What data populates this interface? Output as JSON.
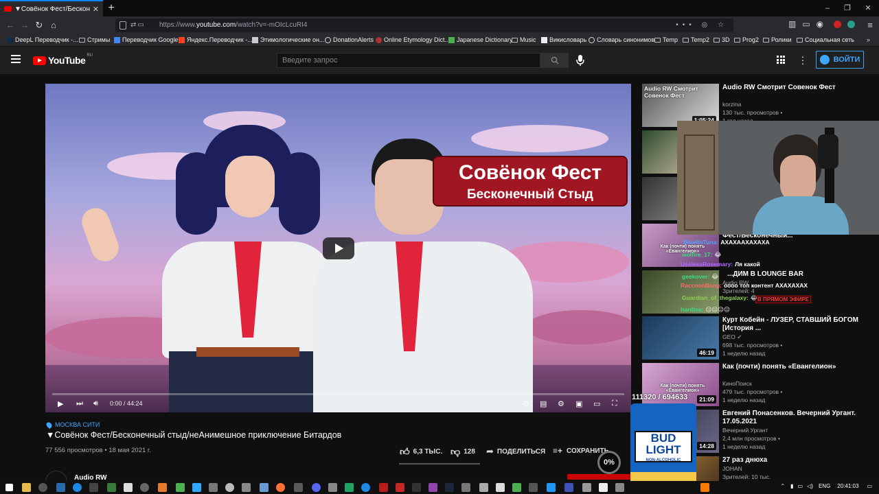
{
  "browser": {
    "tab_title": "▼Совёнок Фест/Бесконечный",
    "new_tab": "+",
    "url_prefix": "https://www.",
    "url_host": "youtube.com",
    "url_rest": "/watch?v=-mOIcLcuRI4",
    "url_more": "•••",
    "window_min": "–",
    "window_max": "❐",
    "window_close": "✕"
  },
  "bookmarks": [
    {
      "label": "DeepL Переводчик -...",
      "icon": "deepl-icon"
    },
    {
      "label": "Стримы",
      "icon": "folder-icon"
    },
    {
      "label": "Переводчик Google",
      "icon": "google-translate-icon"
    },
    {
      "label": "Яндекс.Переводчик -...",
      "icon": "yandex-icon"
    },
    {
      "label": "Этимологические он...",
      "icon": "page-icon"
    },
    {
      "label": "DonationAlerts",
      "icon": "donationalerts-icon"
    },
    {
      "label": "Online Etymology Dict...",
      "icon": "etymology-icon"
    },
    {
      "label": "Japanese Dictionary",
      "icon": "dictionary-icon"
    },
    {
      "label": "Music",
      "icon": "folder-icon"
    },
    {
      "label": "Викисловарь",
      "icon": "wiki-icon"
    },
    {
      "label": "Словарь синонимов",
      "icon": "globe-icon"
    },
    {
      "label": "Temp",
      "icon": "folder-icon"
    },
    {
      "label": "Temp2",
      "icon": "folder-icon"
    },
    {
      "label": "3D",
      "icon": "folder-icon"
    },
    {
      "label": "Prog2",
      "icon": "folder-icon"
    },
    {
      "label": "Ролики",
      "icon": "folder-icon"
    },
    {
      "label": "Социальная сеть",
      "icon": "folder-icon"
    }
  ],
  "youtube": {
    "logo_text": "YouTube",
    "logo_region": "RU",
    "search_placeholder": "Введите запрос",
    "signin_label": "ВОЙТИ"
  },
  "player": {
    "title_card_line1": "Совёнок Фест",
    "title_card_line2": "Бесконечный Стыд",
    "time": "0:00 / 44:24",
    "progress": 0
  },
  "video": {
    "location": "МОСКВА СИТИ",
    "title": "▼Совёнок Фест/Бесконечный стыд/неАнимешное приключение Битардов",
    "views": "77 556 просмотров",
    "date": "18 мая 2021 г.",
    "likes": "6,3 ТЫС.",
    "dislikes": "128",
    "share_label": "ПОДЕЛИТЬСЯ",
    "save_label": "СОХРАНИТЬ",
    "channel": "Audio RW"
  },
  "recommendations": [
    {
      "title": "Audio RW Смотрит Совенок Фест",
      "channel": "korzina",
      "views": "130 тыс. просмотров •",
      "age": "1 год назад",
      "duration": "1:05:24",
      "thumb_text": "Audio RW Смотрит Совенок Фест"
    },
    {
      "title": "",
      "channel": "",
      "views": "",
      "age": "",
      "duration": "",
      "thumb_text": ""
    },
    {
      "title": "",
      "channel": "",
      "views": "",
      "age": "",
      "duration": "",
      "thumb_text": ""
    },
    {
      "title": "Фест/Бесконечный...",
      "channel": "",
      "views": "",
      "age": "",
      "duration": "",
      "thumb_text": "Как (почти) понять «Евангелион»"
    },
    {
      "title": "...ДИМ В LOUNGE BAR",
      "channel": "Audio RW",
      "views": "Зрителей: 4",
      "age": "",
      "duration": "",
      "thumb_text": ""
    },
    {
      "title": "Курт Кобейн - ЛУЗЕР, СТАВШИЙ БОГОМ [История ...",
      "channel": "GEO",
      "views": "698 тыс. просмотров •",
      "age": "1 неделю назад",
      "duration": "46:19",
      "thumb_text": ""
    },
    {
      "title": "Как (почти) понять «Евангелион»",
      "channel": "КиноПоиск",
      "views": "479 тыс. просмотров •",
      "age": "1 неделю назад",
      "duration": "21:09",
      "thumb_text": "Как (почти) понять «Евангелион»"
    },
    {
      "title": "Евгений Понасенков. Вечерний Ургант. 17.05.2021",
      "channel": "Вечерний Ургант",
      "views": "2,4 млн просмотров •",
      "age": "1 неделю назад",
      "duration": "14:28",
      "thumb_text": ""
    },
    {
      "title": "27 раз днюха",
      "channel": "JOHAN",
      "views": "Зрителей: 10 тыс.",
      "age": "",
      "duration": "",
      "thumb_text": ""
    }
  ],
  "chat": [
    {
      "user": "BluefinTuna:",
      "msg": "АХАХААХАХАХА",
      "color": "#4da3ff"
    },
    {
      "user": "wolfire_17:",
      "msg": "",
      "color": "#3ddc84"
    },
    {
      "user": "UselessRosemary:",
      "msg": "Ля какой",
      "color": "#b36bff"
    },
    {
      "user": "geekover:",
      "msg": "",
      "color": "#3ddc84"
    },
    {
      "user": "RaccoonBang:",
      "msg": "оооо топ контент АХАХАХАХ",
      "color": "#ff6b6b"
    },
    {
      "user": "Guardian_of_thegalaxy:",
      "msg": "",
      "color": "#8fd14f"
    },
    {
      "user": "hardtea:",
      "msg": "",
      "color": "#3ddc84"
    }
  ],
  "live_badge": "В ПРЯМОМ ЭФИРЕ",
  "overlay": {
    "counter": "111320 / 694633",
    "can_brand": "BUD LIGHT",
    "can_sub": "NON-ALCOHOLIC",
    "percent": "0%"
  },
  "taskbar": {
    "lang": "ENG",
    "time": "20:41:03"
  },
  "colors": {
    "accent": "#3ea6ff",
    "youtube_red": "#ff0000",
    "header_bg": "#202020",
    "page_bg": "#0f0f0f"
  }
}
